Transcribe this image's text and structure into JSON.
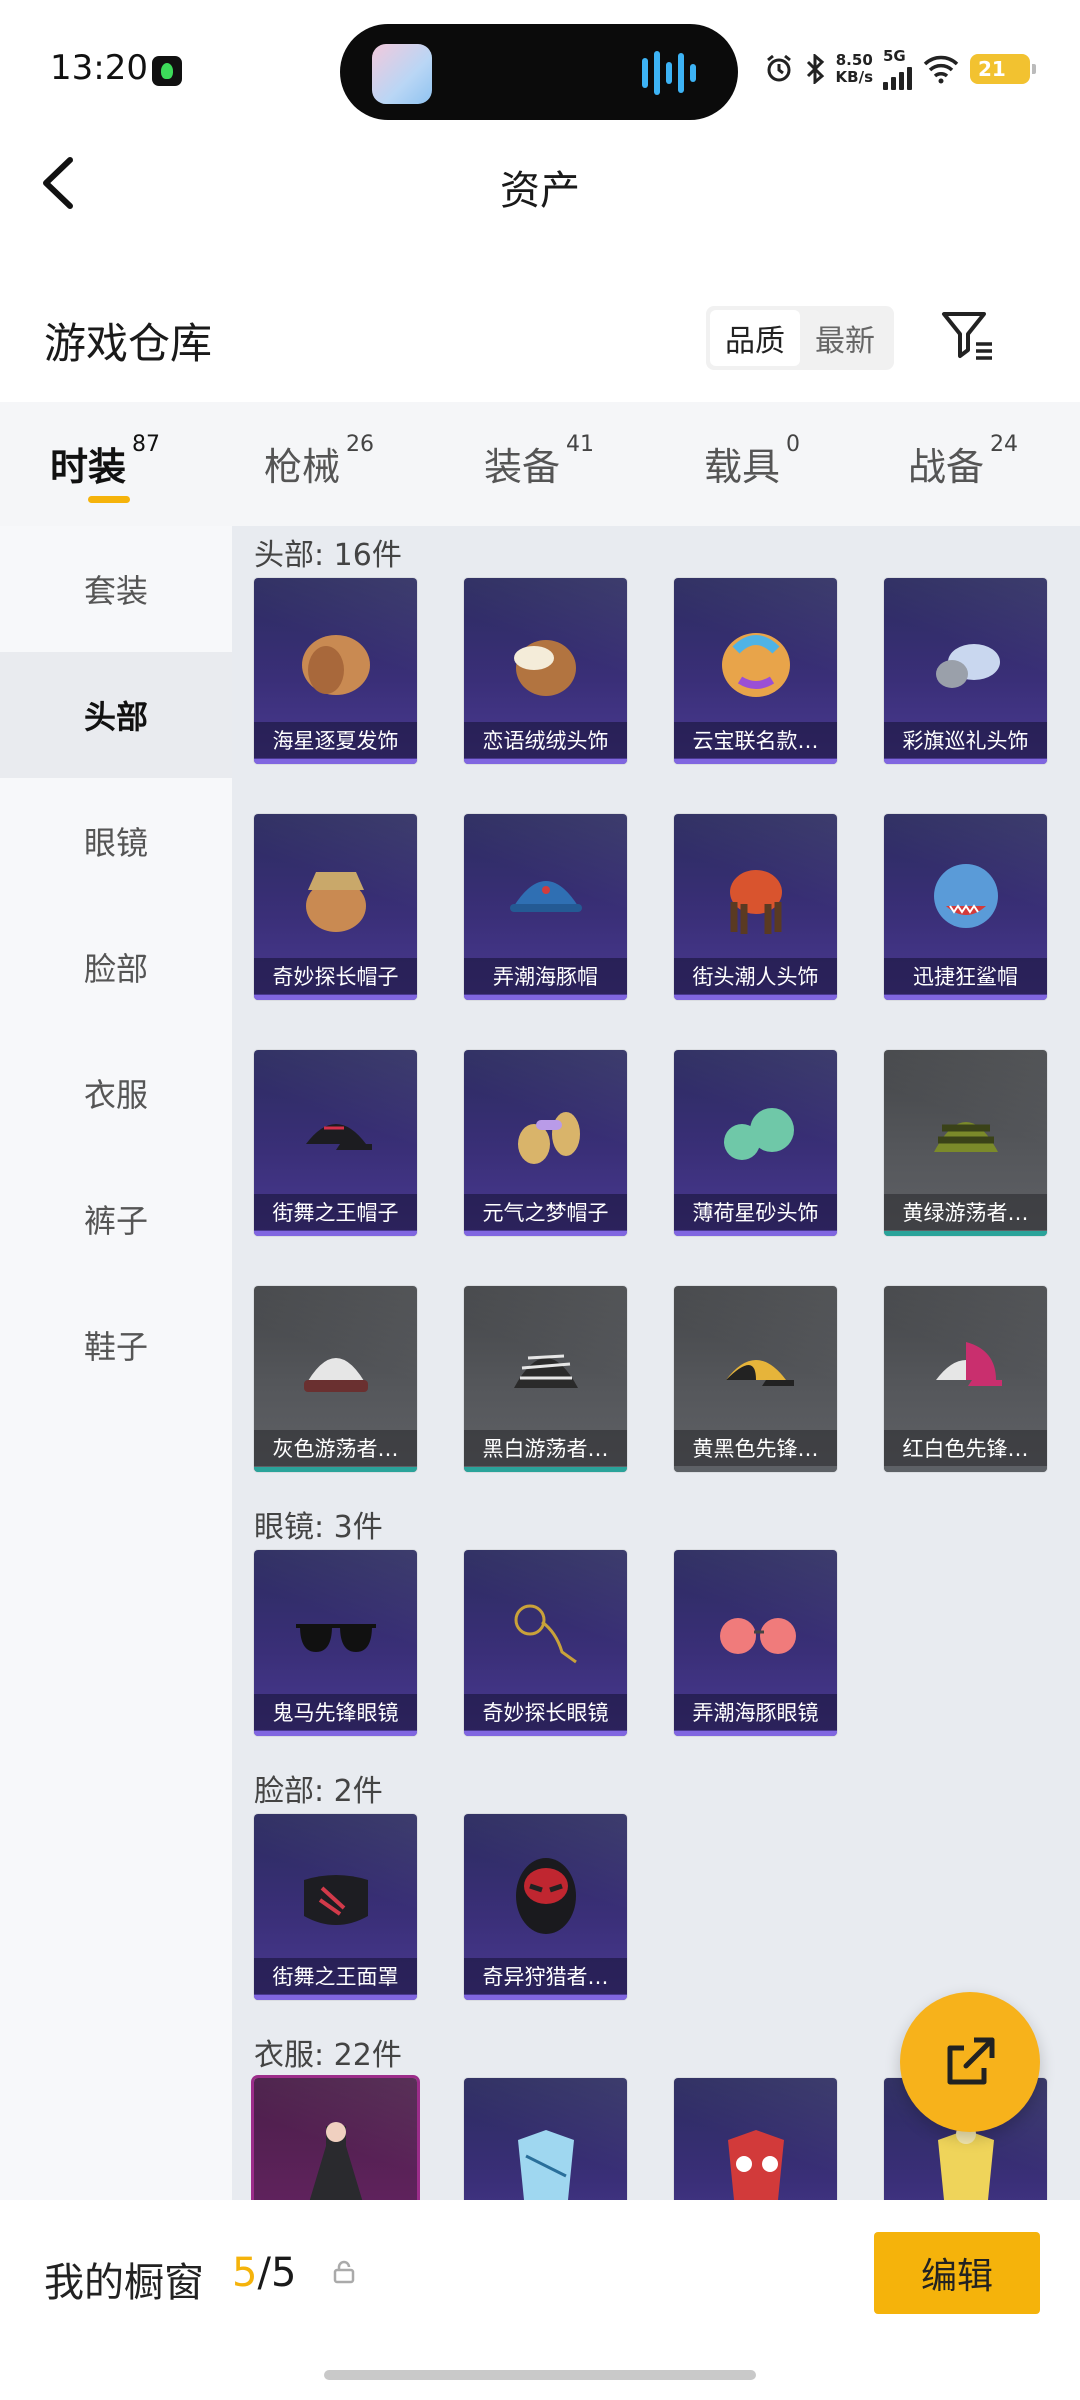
{
  "status_bar": {
    "time": "13:20",
    "net_speed_value": "8.50",
    "net_speed_unit": "KB/s",
    "network": "5G",
    "battery": "21"
  },
  "header": {
    "title": "资产",
    "back_icon": "chevron-left-icon"
  },
  "warehouse": {
    "title": "游戏仓库",
    "sort_options": [
      "品质",
      "最新"
    ],
    "active_sort": "品质",
    "filter_icon": "filter-icon"
  },
  "tabs": [
    {
      "label": "时装",
      "count": "87",
      "active": true
    },
    {
      "label": "枪械",
      "count": "26"
    },
    {
      "label": "装备",
      "count": "41"
    },
    {
      "label": "载具",
      "count": "0"
    },
    {
      "label": "战备",
      "count": "24"
    }
  ],
  "sidebar": [
    {
      "label": "套装"
    },
    {
      "label": "头部",
      "active": true
    },
    {
      "label": "眼镜"
    },
    {
      "label": "脸部"
    },
    {
      "label": "衣服"
    },
    {
      "label": "裤子"
    },
    {
      "label": "鞋子"
    }
  ],
  "groups": [
    {
      "title": "头部: 16件",
      "items": [
        {
          "name": "海星逐夏发饰",
          "style": "purple"
        },
        {
          "name": "恋语绒绒头饰",
          "style": "purple"
        },
        {
          "name": "云宝联名款…",
          "style": "purple"
        },
        {
          "name": "彩旗巡礼头饰",
          "style": "purple"
        },
        {
          "name": "奇妙探长帽子",
          "style": "purple"
        },
        {
          "name": "弄潮海豚帽",
          "style": "purple"
        },
        {
          "name": "街头潮人头饰",
          "style": "purple"
        },
        {
          "name": "迅捷狂鲨帽",
          "style": "purple"
        },
        {
          "name": "街舞之王帽子",
          "style": "purple"
        },
        {
          "name": "元气之梦帽子",
          "style": "purple"
        },
        {
          "name": "薄荷星砂头饰",
          "style": "purple"
        },
        {
          "name": "黄绿游荡者…",
          "style": "gray-teal"
        },
        {
          "name": "灰色游荡者…",
          "style": "gray-teal"
        },
        {
          "name": "黑白游荡者…",
          "style": "gray-teal"
        },
        {
          "name": "黄黑色先锋…",
          "style": "gray"
        },
        {
          "name": "红白色先锋…",
          "style": "gray"
        }
      ]
    },
    {
      "title": "眼镜: 3件",
      "items": [
        {
          "name": "鬼马先锋眼镜",
          "style": "purple"
        },
        {
          "name": "奇妙探长眼镜",
          "style": "purple"
        },
        {
          "name": "弄潮海豚眼镜",
          "style": "purple"
        }
      ]
    },
    {
      "title": "脸部: 2件",
      "items": [
        {
          "name": "街舞之王面罩",
          "style": "purple"
        },
        {
          "name": "奇异狩猎者…",
          "style": "purple"
        }
      ]
    },
    {
      "title": "衣服: 22件",
      "items": [
        {
          "name": "",
          "style": "pink"
        },
        {
          "name": "",
          "style": "purple"
        },
        {
          "name": "",
          "style": "purple"
        },
        {
          "name": "",
          "style": "purple"
        }
      ]
    }
  ],
  "bottom_bar": {
    "label": "我的橱窗",
    "current": "5",
    "separator": "/",
    "total": "5",
    "edit_label": "编辑"
  },
  "colors": {
    "accent": "#f5b30b",
    "epic_card": "#3a2f78",
    "common_card": "#55575b"
  }
}
